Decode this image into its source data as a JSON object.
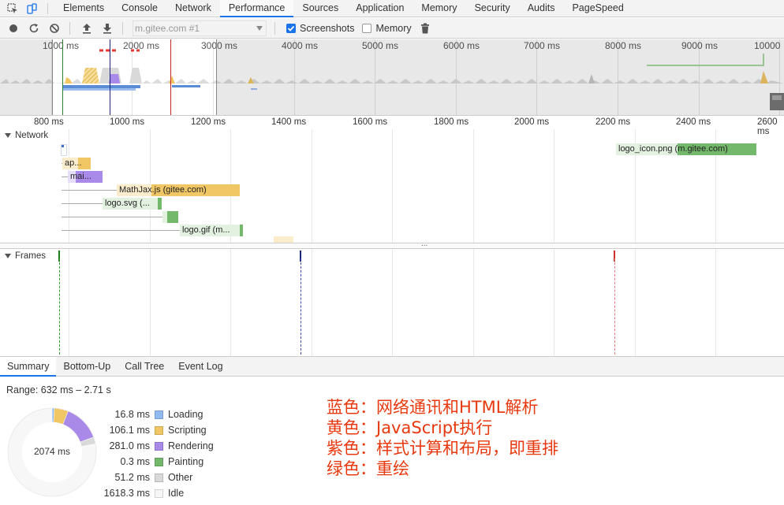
{
  "tabs": [
    {
      "label": "Elements"
    },
    {
      "label": "Console"
    },
    {
      "label": "Network"
    },
    {
      "label": "Performance"
    },
    {
      "label": "Sources"
    },
    {
      "label": "Application"
    },
    {
      "label": "Memory"
    },
    {
      "label": "Security"
    },
    {
      "label": "Audits"
    },
    {
      "label": "PageSpeed"
    }
  ],
  "toolbar": {
    "url_value": "m.gitee.com #1",
    "screenshots_label": "Screenshots",
    "screenshots_checked": true,
    "memory_label": "Memory",
    "memory_checked": false
  },
  "overview": {
    "labels": [
      "1000 ms",
      "2000 ms",
      "3000 ms",
      "4000 ms",
      "5000 ms",
      "6000 ms",
      "7000 ms",
      "8000 ms",
      "9000 ms",
      "10000"
    ]
  },
  "ruler": {
    "labels": [
      "800 ms",
      "1000 ms",
      "1200 ms",
      "1400 ms",
      "1600 ms",
      "1800 ms",
      "2000 ms",
      "2200 ms",
      "2400 ms",
      "2600 ms"
    ]
  },
  "network": {
    "title": "Network",
    "requests": [
      {
        "label": "ap..."
      },
      {
        "label": "mai..."
      },
      {
        "label": "MathJax.js (gitee.com)"
      },
      {
        "label": "logo.svg (..."
      },
      {
        "label": ""
      },
      {
        "label": "logo.gif (m..."
      },
      {
        "label": "logo_icon.png (m.gitee.com)"
      }
    ]
  },
  "frames": {
    "title": "Frames"
  },
  "bottom_tabs": [
    {
      "label": "Summary"
    },
    {
      "label": "Bottom-Up"
    },
    {
      "label": "Call Tree"
    },
    {
      "label": "Event Log"
    }
  ],
  "summary": {
    "range": "Range: 632 ms – 2.71 s",
    "total": "2074 ms",
    "items": [
      {
        "value": "16.8 ms",
        "name": "Loading",
        "color": "#8fb9f0"
      },
      {
        "value": "106.1 ms",
        "name": "Scripting",
        "color": "#f1c665"
      },
      {
        "value": "281.0 ms",
        "name": "Rendering",
        "color": "#a98ae8"
      },
      {
        "value": "0.3 ms",
        "name": "Painting",
        "color": "#74b96b"
      },
      {
        "value": "51.2 ms",
        "name": "Other",
        "color": "#d9d9d9"
      },
      {
        "value": "1618.3 ms",
        "name": "Idle",
        "color": "#f7f7f7"
      }
    ]
  },
  "annotations": [
    "蓝色：网络通讯和HTML解析",
    "黄色：JavaScript执行",
    "紫色：样式计算和布局，即重排",
    "绿色：重绘"
  ]
}
